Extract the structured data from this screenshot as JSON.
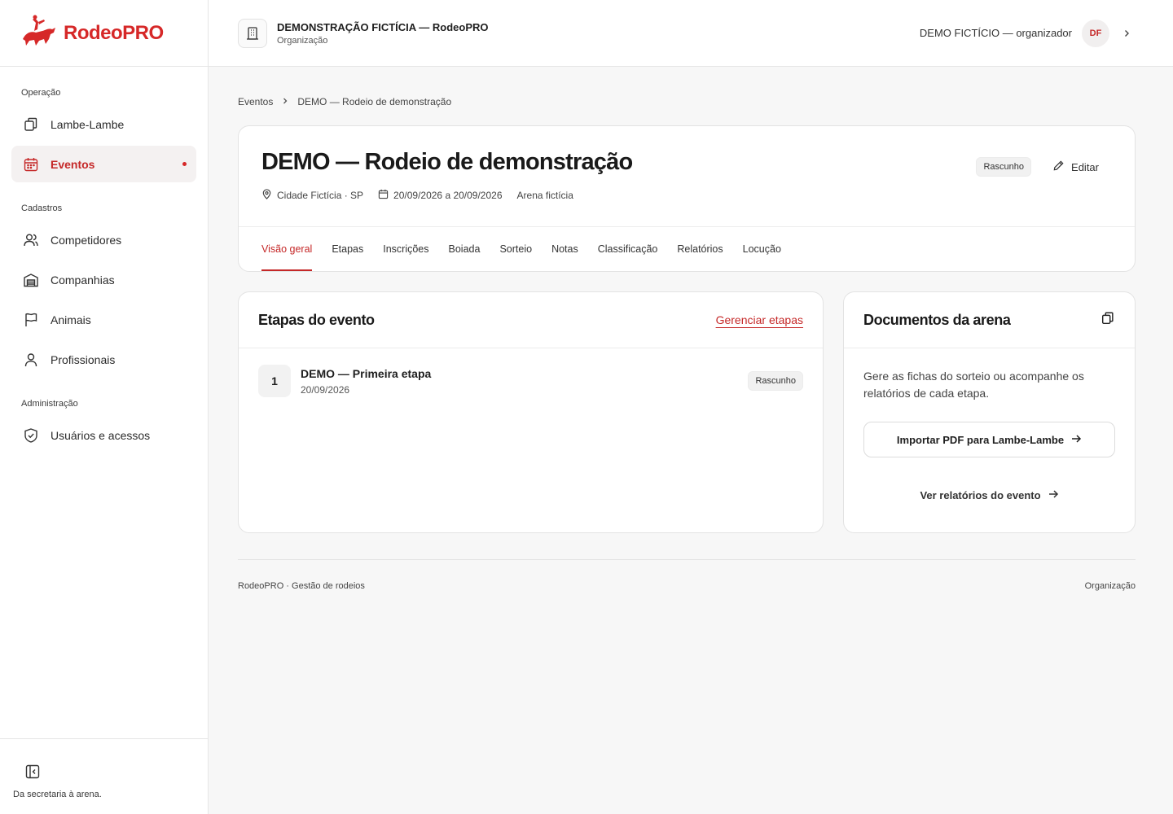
{
  "brand": {
    "name": "RodeoPRO",
    "accent": "#d62828",
    "logo_icon": "bull-rider-logo-icon"
  },
  "sidebar": {
    "sections": [
      {
        "label": "Operação",
        "items": [
          {
            "label": "Lambe-Lambe",
            "icon": "copy-icon"
          },
          {
            "label": "Eventos",
            "icon": "calendar-icon",
            "active": true
          }
        ]
      },
      {
        "label": "Cadastros",
        "items": [
          {
            "label": "Competidores",
            "icon": "users-icon"
          },
          {
            "label": "Companhias",
            "icon": "warehouse-icon"
          },
          {
            "label": "Animais",
            "icon": "flag-icon"
          },
          {
            "label": "Profissionais",
            "icon": "user-icon"
          }
        ]
      },
      {
        "label": "Administração",
        "items": [
          {
            "label": "Usuários e acessos",
            "icon": "shield-icon"
          }
        ]
      }
    ],
    "tagline": "Da secretaria à arena."
  },
  "topbar": {
    "org_name": "DEMONSTRAÇÃO FICTÍCIA — RodeoPRO",
    "org_sub": "Organização",
    "user_name": "DEMO FICTÍCIO — organizador",
    "avatar_initials": "DF"
  },
  "breadcrumb": {
    "root": "Eventos",
    "current": "DEMO — Rodeio de demonstração"
  },
  "event": {
    "title": "DEMO — Rodeio de demonstração",
    "location": "Cidade Fictícia · SP",
    "dates": "20/09/2026 a 20/09/2026",
    "arena": "Arena fictícia",
    "status": "Rascunho",
    "edit_label": "Editar",
    "tabs": [
      "Visão geral",
      "Etapas",
      "Inscrições",
      "Boiada",
      "Sorteio",
      "Notas",
      "Classificação",
      "Relatórios",
      "Locução"
    ],
    "active_tab": "Visão geral"
  },
  "stages_card": {
    "title": "Etapas do evento",
    "manage_label": "Gerenciar etapas",
    "stages": [
      {
        "number": "1",
        "name": "DEMO — Primeira etapa",
        "date": "20/09/2026",
        "status": "Rascunho"
      }
    ]
  },
  "docs_card": {
    "title": "Documentos da arena",
    "text": "Gere as fichas do sorteio ou acompanhe os relatórios de cada etapa.",
    "import_label": "Importar PDF para Lambe-Lambe",
    "reports_label": "Ver relatórios do evento"
  },
  "footer": {
    "left": "RodeoPRO · Gestão de rodeios",
    "right": "Organização"
  }
}
